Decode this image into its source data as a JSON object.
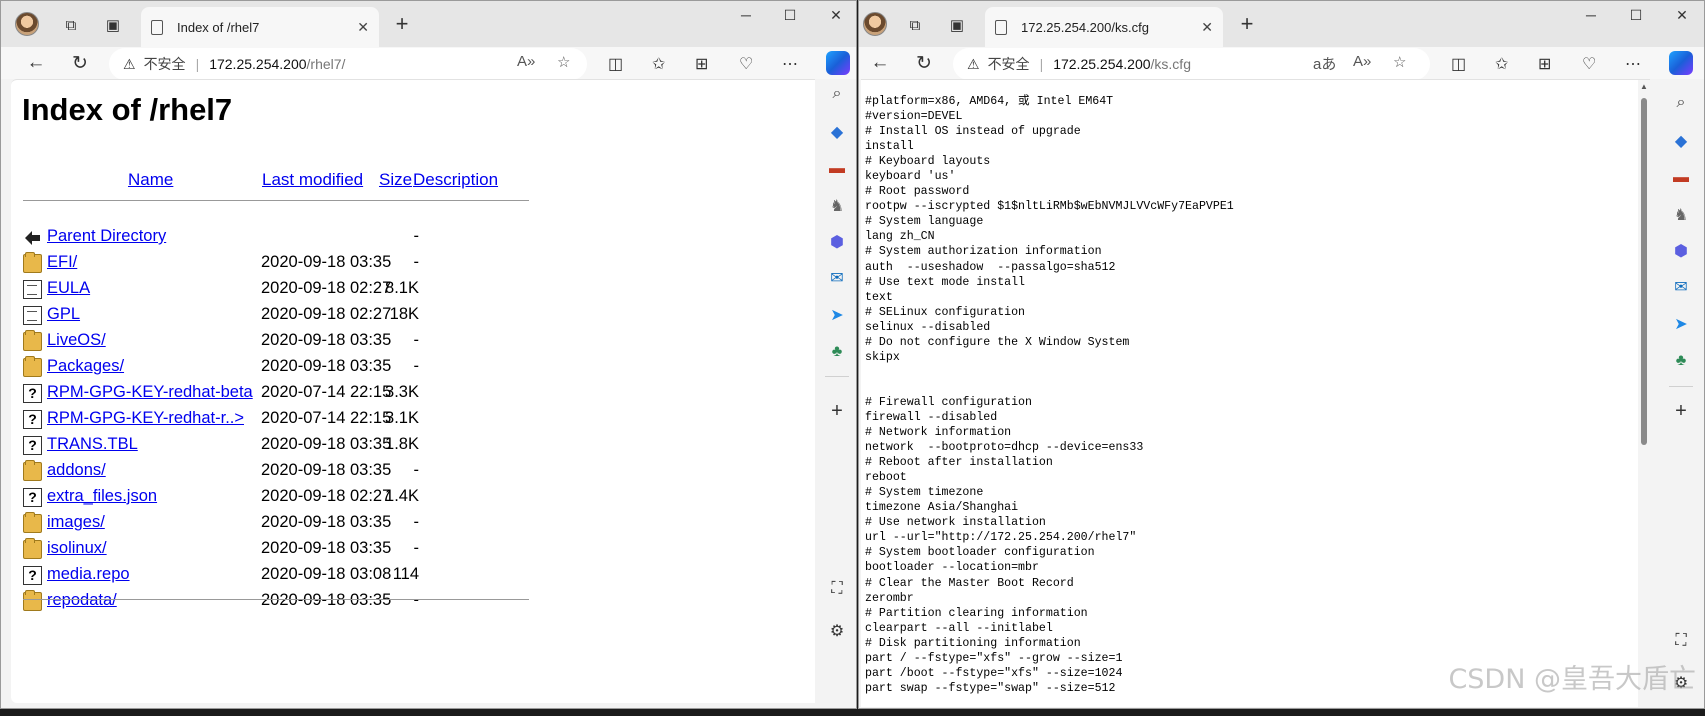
{
  "left": {
    "tab_title": "Index of /rhel7",
    "insecure": "不安全",
    "host": "172.25.254.200",
    "path": "/rhel7/",
    "heading": "Index of /rhel7",
    "columns": {
      "name": "Name",
      "last_modified": "Last modified",
      "size": "Size",
      "description": "Description"
    },
    "rows": [
      {
        "icon": "back",
        "name": "Parent Directory",
        "date": "",
        "size": "-"
      },
      {
        "icon": "folder",
        "name": "EFI/",
        "date": "2020-09-18 03:35",
        "size": "-"
      },
      {
        "icon": "doc",
        "name": "EULA",
        "date": "2020-09-18 02:27",
        "size": "8.1K"
      },
      {
        "icon": "doc",
        "name": "GPL",
        "date": "2020-09-18 02:27",
        "size": "18K"
      },
      {
        "icon": "folder",
        "name": "LiveOS/",
        "date": "2020-09-18 03:35",
        "size": "-"
      },
      {
        "icon": "folder",
        "name": "Packages/",
        "date": "2020-09-18 03:35",
        "size": "-"
      },
      {
        "icon": "unknown",
        "name": "RPM-GPG-KEY-redhat-beta",
        "date": "2020-07-14 22:15",
        "size": "3.3K"
      },
      {
        "icon": "unknown",
        "name": "RPM-GPG-KEY-redhat-r..>",
        "date": "2020-07-14 22:15",
        "size": "3.1K"
      },
      {
        "icon": "unknown",
        "name": "TRANS.TBL",
        "date": "2020-09-18 03:35",
        "size": "1.8K"
      },
      {
        "icon": "folder",
        "name": "addons/",
        "date": "2020-09-18 03:35",
        "size": "-"
      },
      {
        "icon": "unknown",
        "name": "extra_files.json",
        "date": "2020-09-18 02:27",
        "size": "1.4K"
      },
      {
        "icon": "folder",
        "name": "images/",
        "date": "2020-09-18 03:35",
        "size": "-"
      },
      {
        "icon": "folder",
        "name": "isolinux/",
        "date": "2020-09-18 03:35",
        "size": "-"
      },
      {
        "icon": "unknown",
        "name": "media.repo",
        "date": "2020-09-18 03:08",
        "size": "114"
      },
      {
        "icon": "folder",
        "name": "repodata/",
        "date": "2020-09-18 03:35",
        "size": "-"
      }
    ]
  },
  "right": {
    "tab_title": "172.25.254.200/ks.cfg",
    "insecure": "不安全",
    "host": "172.25.254.200",
    "path": "/ks.cfg",
    "file_text": "#platform=x86, AMD64, 或 Intel EM64T\n#version=DEVEL\n# Install OS instead of upgrade\ninstall\n# Keyboard layouts\nkeyboard 'us'\n# Root password\nrootpw --iscrypted $1$nltLiRMb$wEbNVMJLVVcWFy7EaPVPE1\n# System language\nlang zh_CN\n# System authorization information\nauth  --useshadow  --passalgo=sha512\n# Use text mode install\ntext\n# SELinux configuration\nselinux --disabled\n# Do not configure the X Window System\nskipx\n\n\n# Firewall configuration\nfirewall --disabled\n# Network information\nnetwork  --bootproto=dhcp --device=ens33\n# Reboot after installation\nreboot\n# System timezone\ntimezone Asia/Shanghai\n# Use network installation\nurl --url=\"http://172.25.254.200/rhel7\"\n# System bootloader configuration\nbootloader --location=mbr\n# Clear the Master Boot Record\nzerombr\n# Partition clearing information\nclearpart --all --initlabel\n# Disk partitioning information\npart / --fstype=\"xfs\" --grow --size=1\npart /boot --fstype=\"xfs\" --size=1024\npart swap --fstype=\"swap\" --size=512"
  },
  "watermark": "CSDN @皇吾大盾亡"
}
